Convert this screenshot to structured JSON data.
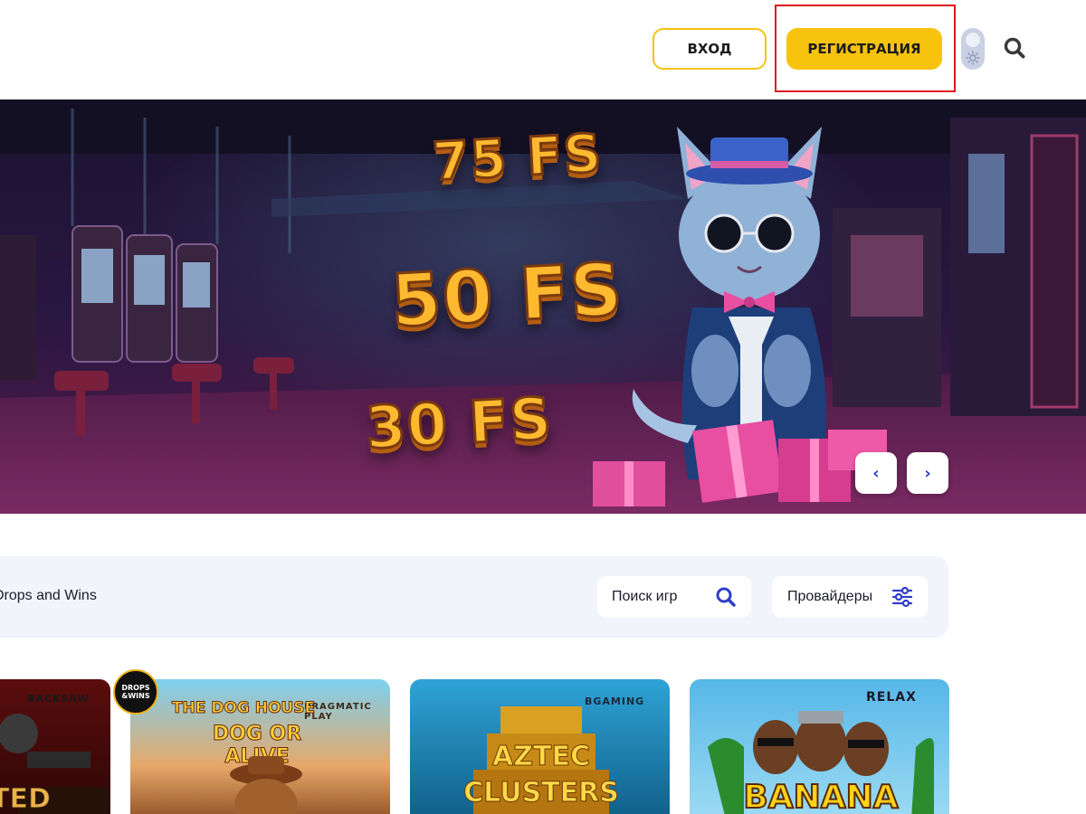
{
  "header": {
    "login_label": "ВХОД",
    "register_label": "РЕГИСТРАЦИЯ"
  },
  "banner": {
    "offers": [
      "75 FS",
      "50 FS",
      "30 FS"
    ],
    "prev_symbol": "‹",
    "next_symbol": "›"
  },
  "filters": {
    "category_label": "Drops and Wins",
    "search_placeholder": "Поиск игр",
    "providers_label": "Провайдеры"
  },
  "games": [
    {
      "provider": "BACKSAW",
      "title": "TED"
    },
    {
      "provider": "PRAGMATIC PLAY",
      "title_line1": "THE DOG HOUSE",
      "title_line2": "DOG OR ALIVE",
      "badge_line1": "DROPS",
      "badge_line2": "&WINS"
    },
    {
      "provider": "BGAMING",
      "title_line1": "AZTEC",
      "title_line2": "CLUSTERS"
    },
    {
      "provider": "RELAX",
      "title": "BANANA"
    }
  ],
  "colors": {
    "accent_yellow": "#f7c30e",
    "highlight_red": "#e0151b",
    "icon_blue": "#2f3ec6"
  }
}
